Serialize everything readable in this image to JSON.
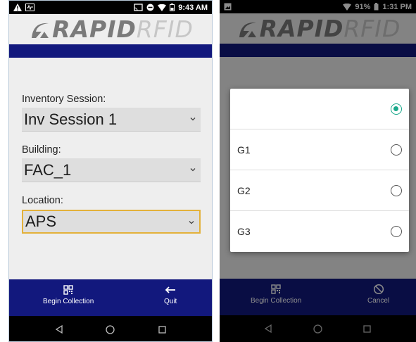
{
  "left": {
    "status_bar": {
      "time": "9:43 AM"
    },
    "logo": {
      "rapid": "RAPID",
      "rfid": "RFID"
    },
    "form": {
      "session_label": "Inventory Session:",
      "session_value": "Inv Session 1",
      "building_label": "Building:",
      "building_value": "FAC_1",
      "location_label": "Location:",
      "location_value": "APS"
    },
    "toolbar": {
      "begin_label": "Begin Collection",
      "quit_label": "Quit"
    }
  },
  "right": {
    "status_bar": {
      "battery": "91%",
      "time": "1:31 PM"
    },
    "logo": {
      "rapid": "RAPID",
      "rfid": "RFID"
    },
    "dialog": {
      "options": [
        {
          "label": "",
          "checked": true
        },
        {
          "label": "G1",
          "checked": false
        },
        {
          "label": "G2",
          "checked": false
        },
        {
          "label": "G3",
          "checked": false
        }
      ]
    },
    "toolbar": {
      "begin_label": "Begin Collection",
      "cancel_label": "Cancel"
    }
  },
  "colors": {
    "navy": "#12187d",
    "accent_radio": "#18a88a",
    "focus_border": "#e3b13a",
    "form_bg": "#eeeeee"
  }
}
